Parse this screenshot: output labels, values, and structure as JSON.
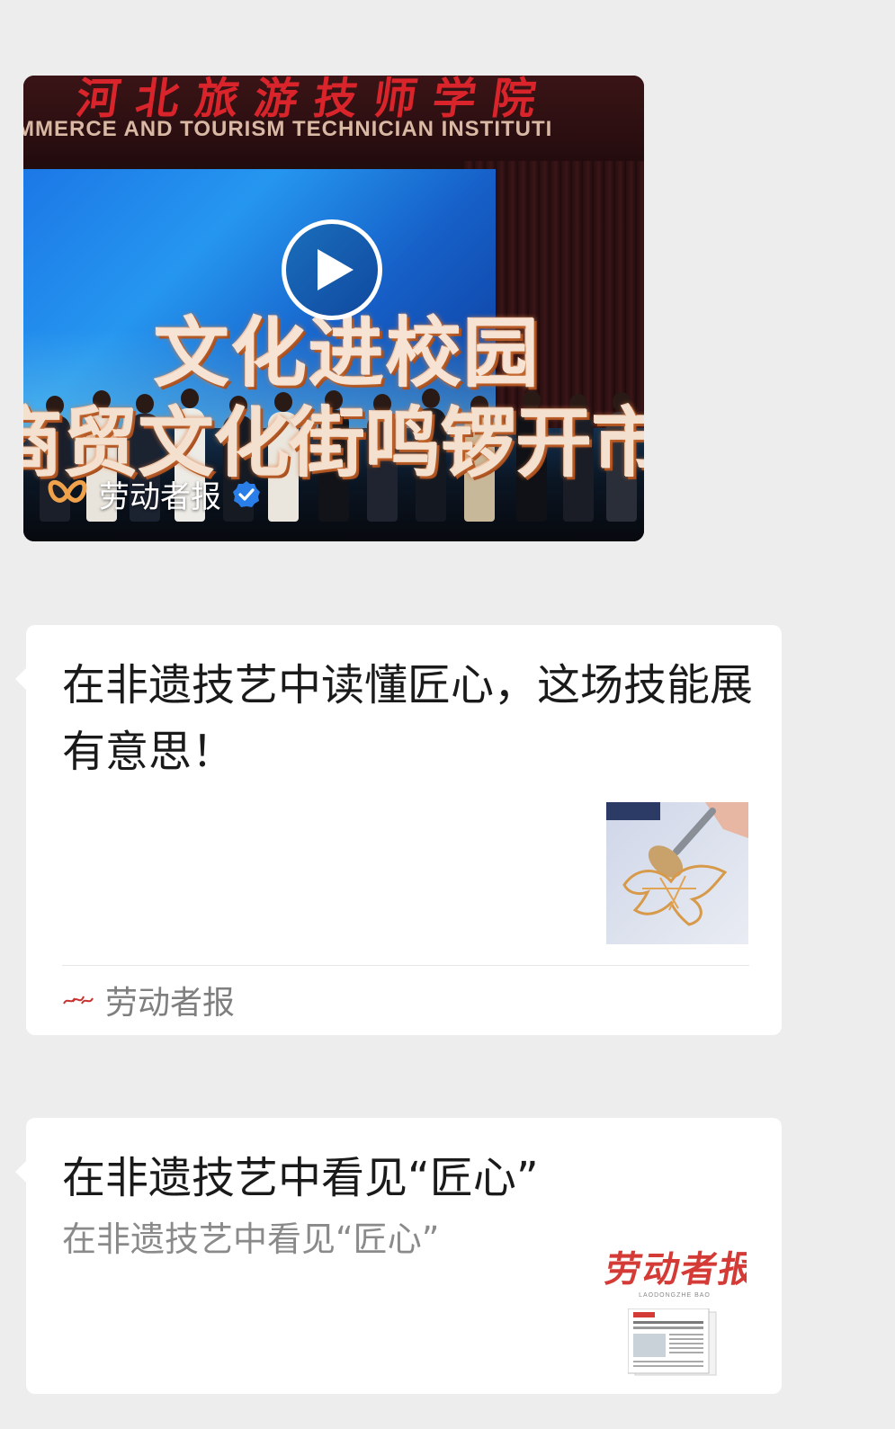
{
  "video_card": {
    "banner_cn": "河北旅游技师学院",
    "banner_en": "MMERCE AND TOURISM TECHNICIAN INSTITUTI",
    "title_line1": "文化进校园",
    "title_line2": "商贸文化街鸣锣开市",
    "source_name": "劳动者报",
    "verified": true,
    "accent_color": "#f0a24a",
    "verified_color": "#2a7ee8",
    "icons": [
      "play-icon",
      "butterfly-logo-icon",
      "verified-badge-icon"
    ]
  },
  "article_1": {
    "title": "在非遗技艺中读懂匠心，这场技能展有意思！",
    "source_name": "劳动者报",
    "thumbnail": "sugar-painting-photo"
  },
  "article_2": {
    "title": "在非遗技艺中看见“匠心”",
    "description": "在非遗技艺中看见“匠心”",
    "thumbnail_masthead": "劳动者报",
    "thumbnail_pinyin": "LAODONGZHE BAO"
  }
}
